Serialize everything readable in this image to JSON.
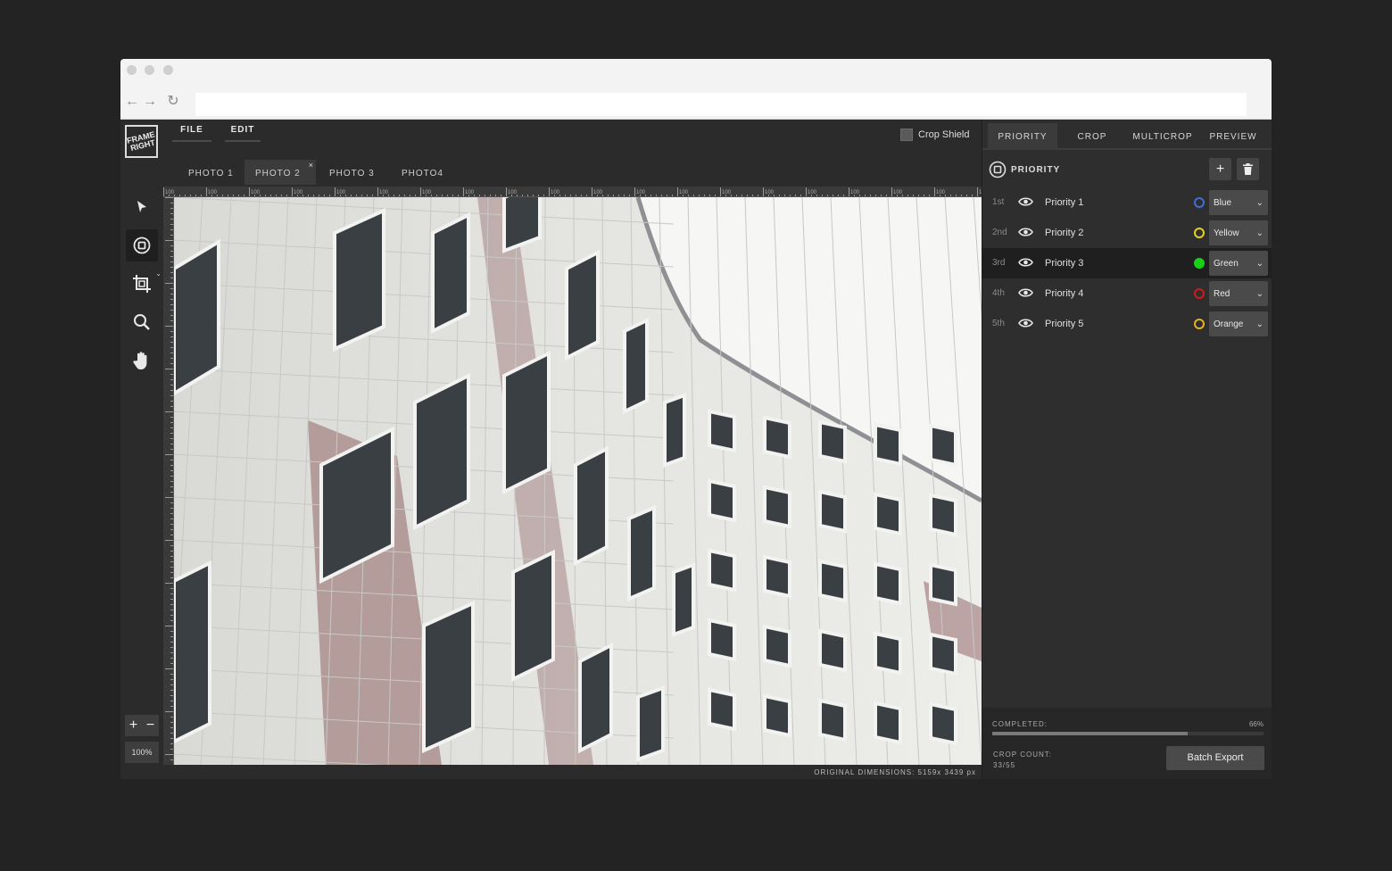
{
  "browser": {
    "url": "",
    "icons": [
      "back-icon",
      "forward-icon",
      "reload-icon"
    ]
  },
  "app": {
    "logo_text": "FRAME RIGHT",
    "menu": [
      {
        "label": "FILE"
      },
      {
        "label": "EDIT"
      }
    ],
    "crop_shield": {
      "label": "Crop Shield",
      "checked": false
    },
    "photo_tabs": [
      {
        "label": "PHOTO 1",
        "active": false
      },
      {
        "label": "PHOTO 2",
        "active": true,
        "close": "×"
      },
      {
        "label": "PHOTO 3",
        "active": false
      },
      {
        "label": "PHOTO4",
        "active": false
      }
    ],
    "tools": [
      "pointer-icon",
      "priority-target-icon",
      "crop-icon",
      "zoom-icon",
      "hand-pan-icon"
    ],
    "zoom": {
      "plus": "+",
      "minus": "−",
      "level": "100%"
    },
    "ruler_label": "100",
    "original_dimensions": "ORIGINAL DIMENSIONS: 5159x 3439 px"
  },
  "panel": {
    "tabs": [
      {
        "label": "PRIORITY",
        "active": true
      },
      {
        "label": "CROP",
        "active": false
      },
      {
        "label": "MULTICROP",
        "active": false
      },
      {
        "label": "PREVIEW",
        "active": false
      }
    ],
    "section_title": "PRIORITY",
    "add_label": "+",
    "priorities": [
      {
        "rank": "1st",
        "name": "Priority 1",
        "color_name": "Blue",
        "color": "#3f6fd6",
        "filled": false
      },
      {
        "rank": "2nd",
        "name": "Priority 2",
        "color_name": "Yellow",
        "color": "#e6d020",
        "filled": false
      },
      {
        "rank": "3rd",
        "name": "Priority 3",
        "color_name": "Green",
        "color": "#19d019",
        "filled": true
      },
      {
        "rank": "4th",
        "name": "Priority 4",
        "color_name": "Red",
        "color": "#d21a1a",
        "filled": false
      },
      {
        "rank": "5th",
        "name": "Priority 5",
        "color_name": "Orange",
        "color": "#e6b020",
        "filled": false
      }
    ],
    "footer": {
      "completed_label": "COMPLETED:",
      "completed_pct": "66%",
      "completed_fraction": 0.72,
      "crop_count_label": "CROP COUNT:",
      "crop_count": "33/55",
      "batch_export": "Batch Export"
    }
  }
}
